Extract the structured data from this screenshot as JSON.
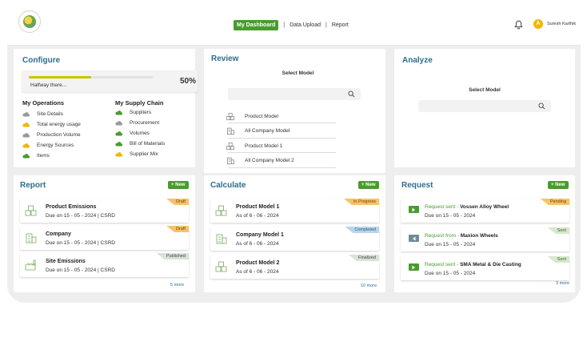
{
  "header": {
    "nav": {
      "dashboard": "My Dashboard",
      "sep1": "|",
      "upload": "Data Upload",
      "sep2": "|",
      "report": "Report"
    },
    "user": {
      "initial": "A",
      "name": "Suresh Karthik"
    }
  },
  "configure": {
    "title": "Configure",
    "progress_label": "Halfway there...",
    "progress_pct": "50%",
    "progress_value": 0.5,
    "operations": {
      "heading": "My Operations",
      "items": [
        {
          "label": "Site Details",
          "color": "#9a9a9a"
        },
        {
          "label": "Total energy usage",
          "color": "#f2b600"
        },
        {
          "label": "Production Volume",
          "color": "#9a9a9a"
        },
        {
          "label": "Energy Sources",
          "color": "#f2b600"
        },
        {
          "label": "Items",
          "color": "#4a9b2f"
        }
      ]
    },
    "supply_chain": {
      "heading": "My Supply Chain",
      "items": [
        {
          "label": "Suppliers",
          "color": "#4a9b2f"
        },
        {
          "label": "Procurement",
          "color": "#9a9a9a"
        },
        {
          "label": "Volumes",
          "color": "#4a9b2f"
        },
        {
          "label": "Bill of Materials",
          "color": "#4a9b2f"
        },
        {
          "label": "Supplier Mix",
          "color": "#f2b600"
        }
      ]
    }
  },
  "review": {
    "title": "Review",
    "select_label": "Select Model",
    "models": [
      "Product Model",
      "All Company Model",
      "Product Model 1",
      "All Company Model 2"
    ]
  },
  "analyze": {
    "title": "Analyze",
    "select_label": "Select Model"
  },
  "report": {
    "title": "Report",
    "new_label": "+ New",
    "more_label": "5 more",
    "items": [
      {
        "title": "Product Emissions",
        "subtitle": "Due on 15 - 05 - 2024   |   CSRD",
        "tag": "Draft"
      },
      {
        "title": "Company",
        "subtitle": "Due on 15 - 05 - 2024   |   CSRD",
        "tag": "Draft"
      },
      {
        "title": "Site Emissions",
        "subtitle": "Due on 15 - 05 - 2024   |   CSRD",
        "tag": "Published"
      }
    ]
  },
  "calculate": {
    "title": "Calculate",
    "new_label": "+ New",
    "more_label": "10 more",
    "items": [
      {
        "title": "Product Model 1",
        "subtitle": "As of 6 - 06 - 2024",
        "tag": "In Progress"
      },
      {
        "title": "Company Model 1",
        "subtitle": "As of 6 - 06 - 2024",
        "tag": "Completed"
      },
      {
        "title": "Product Model 2",
        "subtitle": "As of 6 - 06 - 2024",
        "tag": "Finalized"
      }
    ]
  },
  "request": {
    "title": "Request",
    "new_label": "+ New",
    "more_label": "3 more",
    "items": [
      {
        "prefix": "Request sent - ",
        "name": "Vossen Alloy Wheel",
        "subtitle": "Due on 15 - 05 - 2024",
        "tag": "Pending",
        "direction": "sent"
      },
      {
        "prefix": "Request from - ",
        "name": "Maxion Wheels",
        "subtitle": "Due on 15 - 05 - 2024",
        "tag": "Sent",
        "direction": "from"
      },
      {
        "prefix": "Request sent - ",
        "name": "SMA Metal & Die Casting",
        "subtitle": "Due on 15 - 05 - 2024",
        "tag": "Sent",
        "direction": "sent"
      }
    ]
  },
  "colors": {
    "brand_green": "#4a9b2f",
    "title_blue": "#2f6e8e",
    "accent_yellow": "#f2b600"
  }
}
